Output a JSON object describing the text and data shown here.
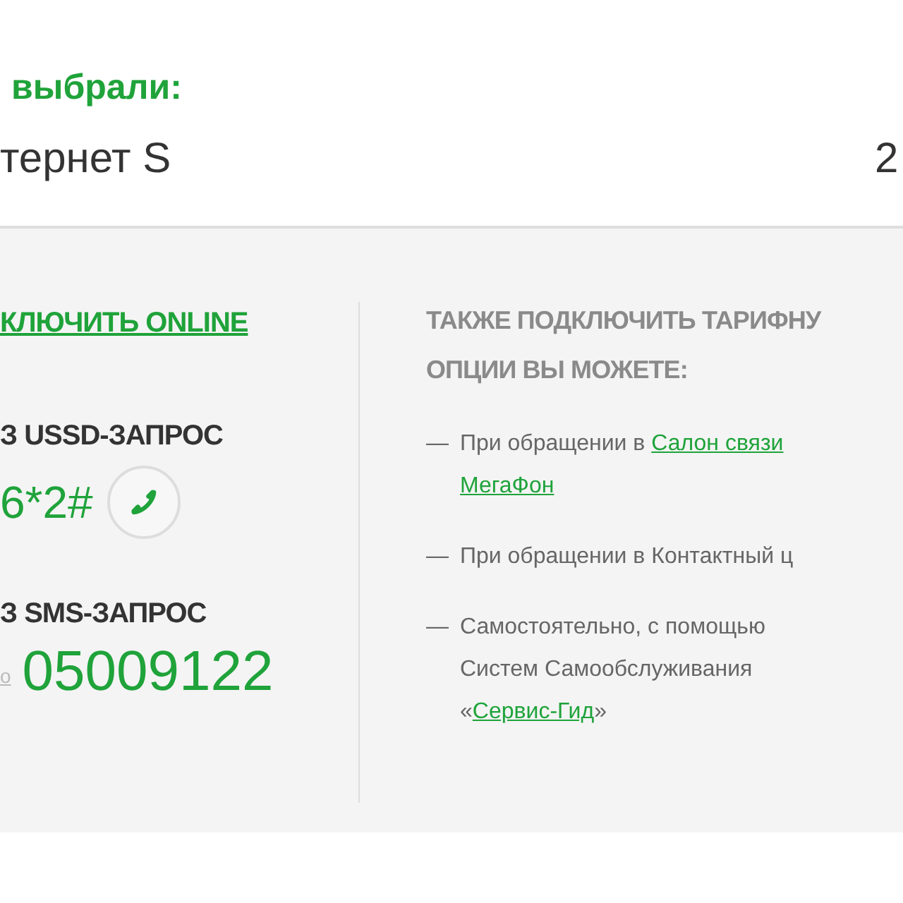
{
  "header": {
    "label": "выбрали:",
    "tariff": "тернет S",
    "price": "2"
  },
  "left": {
    "online_link": "КЛЮЧИТЬ ONLINE",
    "ussd": {
      "title": "З USSD-ЗАПРОС",
      "code": "6*2#"
    },
    "sms": {
      "title": "З SMS-ЗАПРОС",
      "prefix": "о",
      "number": "05009122"
    }
  },
  "right": {
    "heading": [
      "ТАКЖЕ ПОДКЛЮЧИТЬ ТАРИФНУ",
      "ОПЦИИ ВЫ МОЖЕТЕ:"
    ],
    "items": [
      {
        "dash": "—",
        "lines": [
          {
            "text": "При обращении в ",
            "link": "Салон связи"
          },
          {
            "link": "МегаФон"
          }
        ]
      },
      {
        "dash": "—",
        "lines": [
          {
            "text": "При обращении в Контактный ц"
          }
        ]
      },
      {
        "dash": "—",
        "lines": [
          {
            "text": "Самостоятельно, с помощью"
          },
          {
            "text": "Систем Самообслуживания"
          },
          {
            "text": "«",
            "link": "Сервис-Гид",
            "after": "»"
          }
        ]
      }
    ]
  }
}
